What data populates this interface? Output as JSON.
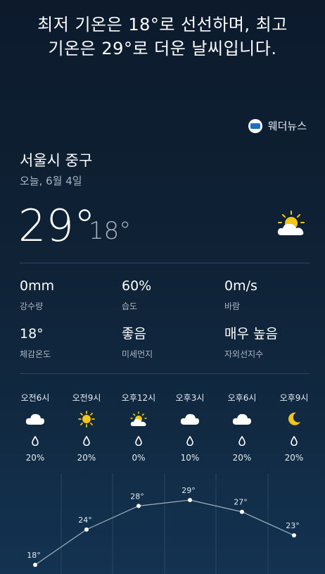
{
  "summary": {
    "line1": "최저 기온은 18°로 선선하며, 최고",
    "line2": "기온은 29°로 더운 날씨입니다."
  },
  "provider": {
    "name": "웨더뉴스",
    "icon": "weathernews-logo-icon"
  },
  "location": "서울시 중구",
  "date": "오늘, 6월 4일",
  "current": {
    "high": "29°",
    "low": "18°",
    "icon": "partly-cloudy-icon"
  },
  "stats": [
    {
      "value": "0mm",
      "label": "강수량"
    },
    {
      "value": "60%",
      "label": "습도"
    },
    {
      "value": "0m/s",
      "label": "바람"
    },
    {
      "value": "18°",
      "label": "체감온도"
    },
    {
      "value": "좋음",
      "label": "미세먼지"
    },
    {
      "value": "매우 높음",
      "label": "자외선지수"
    }
  ],
  "hourly": [
    {
      "time": "오전6시",
      "icon": "cloud-icon",
      "precip": "20%",
      "temp": 18,
      "temp_label": "18°"
    },
    {
      "time": "오전9시",
      "icon": "sun-icon",
      "precip": "20%",
      "temp": 24,
      "temp_label": "24°"
    },
    {
      "time": "오후12시",
      "icon": "partly-cloudy-icon",
      "precip": "0%",
      "temp": 28,
      "temp_label": "28°"
    },
    {
      "time": "오후3시",
      "icon": "cloud-icon",
      "precip": "10%",
      "temp": 29,
      "temp_label": "29°"
    },
    {
      "time": "오후6시",
      "icon": "cloud-icon",
      "precip": "20%",
      "temp": 27,
      "temp_label": "27°"
    },
    {
      "time": "오후9시",
      "icon": "moon-icon",
      "precip": "20%",
      "temp": 23,
      "temp_label": "23°"
    }
  ],
  "colors": {
    "sun": "#f5c518",
    "cloud": "#ffffff",
    "line": "#9fb0c2"
  }
}
